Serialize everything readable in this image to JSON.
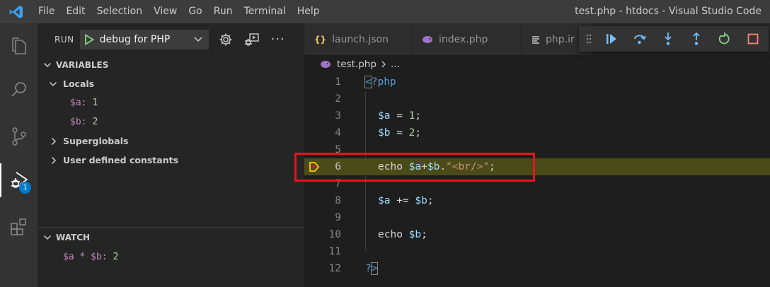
{
  "titlebar": {
    "menu": [
      "File",
      "Edit",
      "Selection",
      "View",
      "Go",
      "Run",
      "Terminal",
      "Help"
    ],
    "window_title": "test.php - htdocs - Visual Studio Code"
  },
  "activity": {
    "icons": [
      "explorer-icon",
      "search-icon",
      "source-control-icon",
      "run-debug-icon",
      "extensions-icon"
    ],
    "debug_badge": "1"
  },
  "sidebar": {
    "run_label": "RUN",
    "config_name": "debug for PHP",
    "variables_header": "VARIABLES",
    "locals_label": "Locals",
    "locals": [
      {
        "name": "$a:",
        "value": "1"
      },
      {
        "name": "$b:",
        "value": "2"
      }
    ],
    "superglobals_label": "Superglobals",
    "constants_label": "User defined constants",
    "watch_header": "WATCH",
    "watch": [
      {
        "expr": "$a * $b:",
        "value": "2"
      }
    ]
  },
  "editor": {
    "tabs": [
      {
        "icon": "{}",
        "label": "launch.json"
      },
      {
        "icon": "php-elephant-icon",
        "label": "index.php"
      },
      {
        "icon": "file-lines-icon",
        "label": "php.ir"
      }
    ],
    "breadcrumb": {
      "file": "test.php",
      "rest": "…"
    },
    "current_line": 6,
    "lines": [
      {
        "num": "1",
        "code": "<?php"
      },
      {
        "num": "2",
        "code": ""
      },
      {
        "num": "3",
        "code": "$a = 1;"
      },
      {
        "num": "4",
        "code": "$b = 2;"
      },
      {
        "num": "5",
        "code": ""
      },
      {
        "num": "6",
        "code": "echo $a+$b.\"<br/>\";"
      },
      {
        "num": "7",
        "code": ""
      },
      {
        "num": "8",
        "code": "$a += $b;"
      },
      {
        "num": "9",
        "code": ""
      },
      {
        "num": "10",
        "code": "echo $b;"
      },
      {
        "num": "11",
        "code": ""
      },
      {
        "num": "12",
        "code": "?>"
      }
    ]
  },
  "debug_toolbar": {
    "buttons": [
      "drag-handle-icon",
      "continue-icon",
      "step-over-icon",
      "step-into-icon",
      "step-out-icon",
      "restart-icon",
      "stop-icon"
    ]
  },
  "colors": {
    "accent": "#007acc",
    "current_line": "#4b4b18",
    "highlight_box": "#e8131b"
  }
}
